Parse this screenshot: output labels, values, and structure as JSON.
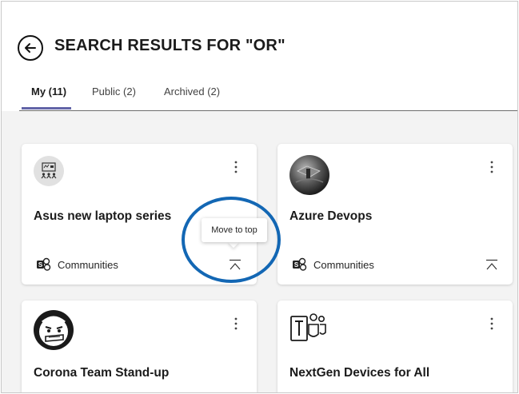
{
  "header": {
    "title": "SEARCH RESULTS FOR \"OR\"",
    "tabs": [
      {
        "label": "My (11)",
        "active": true
      },
      {
        "label": "Public (2)",
        "active": false
      },
      {
        "label": "Archived (2)",
        "active": false
      }
    ]
  },
  "cards": [
    {
      "title": "Asus new laptop series",
      "type": "Communities",
      "icon": "meeting-room-icon"
    },
    {
      "title": "Azure Devops",
      "type": "Communities",
      "icon": "azure-devops-avatar"
    },
    {
      "title": "Corona Team Stand-up",
      "type": "",
      "icon": "corona-face-icon"
    },
    {
      "title": "NextGen Devices for All",
      "type": "",
      "icon": "teams-icon"
    }
  ],
  "tooltip": {
    "text": "Move to top"
  },
  "colors": {
    "accent": "#6264a7",
    "highlight": "#1367b4"
  }
}
